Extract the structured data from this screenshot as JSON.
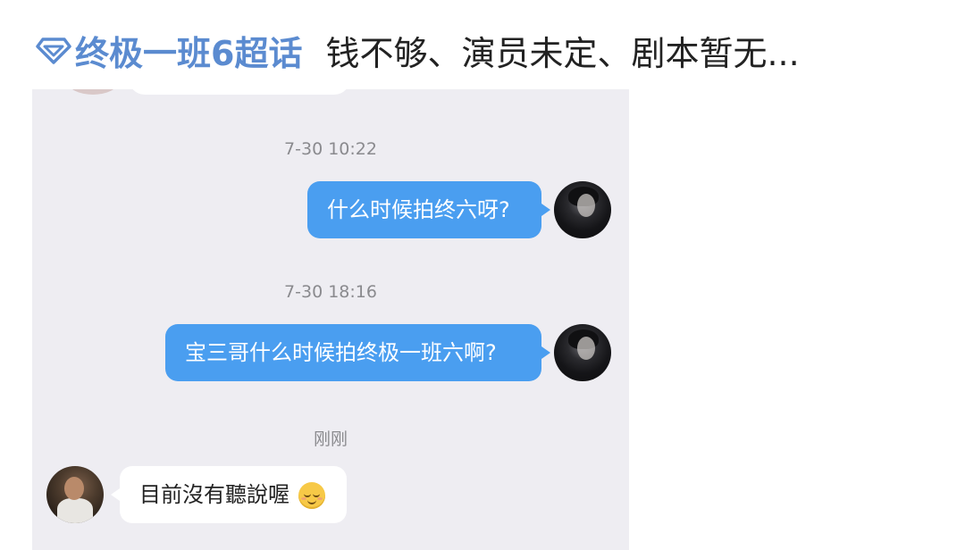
{
  "header": {
    "topic": "终极一班6超话",
    "title": "钱不够、演员未定、剧本暂无...",
    "topic_color": "#5b8bd0"
  },
  "chat": {
    "messages": [
      {
        "timestamp": "7-30 10:22",
        "direction": "out",
        "text": "什么时候拍终六呀?",
        "avatar": "dark-portrait-avatar"
      },
      {
        "timestamp": "7-30 18:16",
        "direction": "out",
        "text": "宝三哥什么时候拍终极一班六啊?",
        "avatar": "dark-portrait-avatar"
      },
      {
        "timestamp": "刚刚",
        "direction": "in",
        "text": "目前沒有聽說喔",
        "emoji": "relieved-face-emoji",
        "avatar": "photo-avatar"
      }
    ],
    "colors": {
      "background": "#eeedf2",
      "outgoing_bubble": "#4a9ef0",
      "incoming_bubble": "#ffffff"
    }
  }
}
